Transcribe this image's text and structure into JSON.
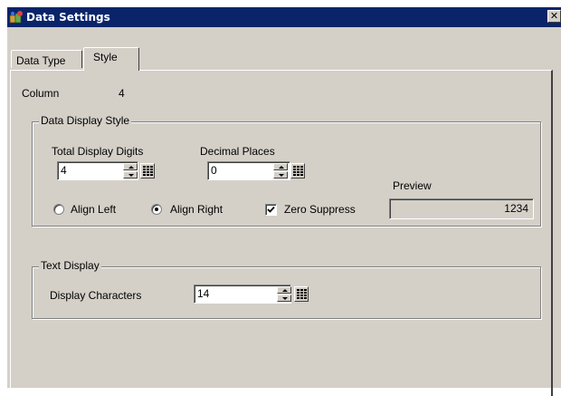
{
  "window": {
    "title": "Data Settings",
    "close_glyph": "✕",
    "icon": "app-icon"
  },
  "tabs": [
    {
      "label": "Data Type",
      "active": false
    },
    {
      "label": "Style",
      "active": true
    }
  ],
  "column": {
    "label": "Column",
    "value": "4"
  },
  "data_display_style": {
    "group_title": "Data Display Style",
    "total_digits": {
      "label": "Total Display Digits",
      "value": "4"
    },
    "decimal_places": {
      "label": "Decimal Places",
      "value": "0"
    },
    "align_left": {
      "label": "Align Left",
      "checked": false
    },
    "align_right": {
      "label": "Align Right",
      "checked": true
    },
    "zero_suppress": {
      "label": "Zero Suppress",
      "checked": true
    },
    "preview": {
      "label": "Preview",
      "value": "1234"
    }
  },
  "text_display": {
    "group_title": "Text Display",
    "display_characters": {
      "label": "Display Characters",
      "value": "14"
    }
  },
  "colors": {
    "titlebar": "#0a246a",
    "face": "#d4d0c8"
  }
}
